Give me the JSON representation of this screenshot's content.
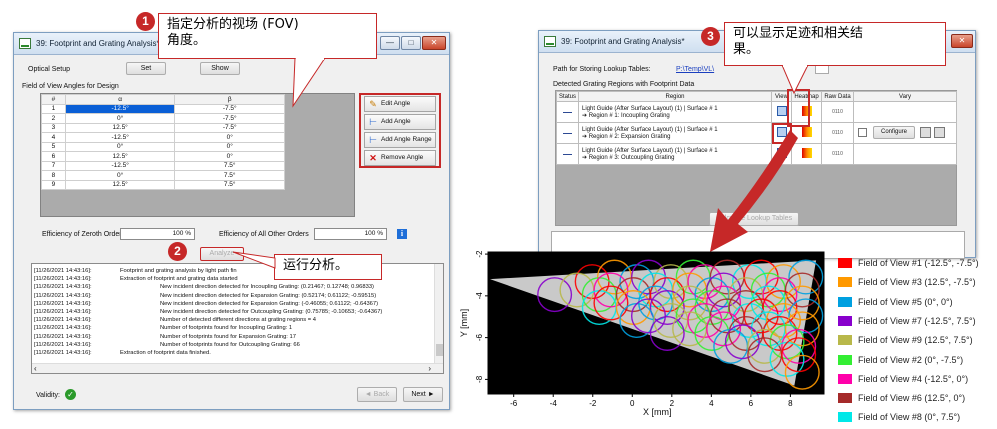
{
  "left_window": {
    "title": "39: Footprint and Grating Analysis*",
    "controls": {
      "minimize": "—",
      "maximize": "□",
      "close": "✕"
    },
    "optical_setup_label": "Optical Setup",
    "set_button": "Set",
    "show_button": "Show",
    "fov_section_label": "Field of View Angles for Design",
    "table_headers": [
      "#",
      "α",
      "β"
    ],
    "rows": [
      [
        "1",
        "-12.5°",
        "-7.5°"
      ],
      [
        "2",
        "0°",
        "-7.5°"
      ],
      [
        "3",
        "12.5°",
        "-7.5°"
      ],
      [
        "4",
        "-12.5°",
        "0°"
      ],
      [
        "5",
        "0°",
        "0°"
      ],
      [
        "6",
        "12.5°",
        "0°"
      ],
      [
        "7",
        "-12.5°",
        "7.5°"
      ],
      [
        "8",
        "0°",
        "7.5°"
      ],
      [
        "9",
        "12.5°",
        "7.5°"
      ]
    ],
    "side_buttons": [
      "Edit Angle",
      "Add Angle",
      "Add Angle Range",
      "Remove Angle"
    ],
    "zeroth_order_label": "Efficiency of Zeroth Order",
    "zeroth_order_value": "100 %",
    "other_orders_label": "Efficiency of All Other Orders",
    "other_orders_value": "100 %",
    "info_icon": "i",
    "analyze_button": "Analyze",
    "log_lines": [
      [
        "[11/26/2021 14:43:16]:",
        "Footprint and grating analysis by light path fin"
      ],
      [
        "[11/26/2021 14:43:16]:",
        "Extraction of footprint and grating data started"
      ],
      [
        "[11/26/2021 14:43:16]:",
        "New incident direction detected for Incoupling Grating: (0.21467; 0.12748; 0.96833)"
      ],
      [
        "[11/26/2021 14:43:16]:",
        "New incident direction detected for Expansion Grating: (0.52174; 0.61122; -0.59515)"
      ],
      [
        "[11/26/2021 14:43:16]:",
        "New incident direction detected for Expansion Grating: (-0.46055; 0.61122; -0.64367)"
      ],
      [
        "[11/26/2021 14:43:16]:",
        "New incident direction detected for Outcoupling Grating: (0.75785; -0.10653; -0.64367)"
      ],
      [
        "[11/26/2021 14:43:16]:",
        "Number of detected different directions at grating regions = 4"
      ],
      [
        "[11/26/2021 14:43:16]:",
        "Number of footprints found for Incoupling Grating: 1"
      ],
      [
        "[11/26/2021 14:43:16]:",
        "Number of footprints found for Expansion Grating: 17"
      ],
      [
        "[11/26/2021 14:43:16]:",
        "Number of footprints found for Outcoupling Grating: 66"
      ],
      [
        "[11/26/2021 14:43:16]:",
        "Extraction of footprint data finished."
      ]
    ],
    "validity_label": "Validity:",
    "back_button": "◄ Back",
    "next_button": "Next ►"
  },
  "callouts": {
    "c1_number": "1",
    "c1_text_line1": "指定分析的视场  (FOV)",
    "c1_text_line2": "角度。",
    "c2_number": "2",
    "c2_text": "运行分析。",
    "c3_number": "3",
    "c3_text_line1": "可以显示足迹和相关结",
    "c3_text_line2": "果。"
  },
  "right_window": {
    "title": "39: Footprint and Grating Analysis*",
    "path_label": "Path for Storing Lookup Tables:",
    "path_link": "P:\\Temp\\VL\\",
    "detected_label": "Detected Grating Regions with Footprint Data",
    "headers": [
      "Status",
      "Region",
      "View",
      "Heatmap",
      "Raw Data",
      "Vary"
    ],
    "regions": [
      {
        "line1": "Light Guide (After Surface Layout) (1) | Surface # 1",
        "line2": "➔ Region # 1: Incoupling Grating"
      },
      {
        "line1": "Light Guide (After Surface Layout) (1) | Surface # 1",
        "line2": "➔ Region # 2: Expansion Grating"
      },
      {
        "line1": "Light Guide (After Surface Layout) (1) | Surface # 1",
        "line2": "➔ Region # 3: Outcoupling Grating"
      }
    ],
    "status_symbol": "—",
    "raw_data_icon": "0110",
    "configure_button": "Configure",
    "calc_button": "Calculate Lookup Tables"
  },
  "plot": {
    "xlabel": "X [mm]",
    "ylabel": "Y [mm]",
    "xticks": [
      "-6",
      "-4",
      "-2",
      "0",
      "2",
      "4",
      "6",
      "8"
    ],
    "yticks": [
      "-2",
      "-4",
      "-6",
      "-8"
    ],
    "xlim": [
      -7.3,
      9.7
    ],
    "ylim": [
      -8.7,
      -1.9
    ],
    "legend": [
      {
        "label": "Field of View #1 (-12.5°, -7.5°)",
        "color": "#ff0000"
      },
      {
        "label": "Field of View #3 (12.5°, -7.5°)",
        "color": "#ff9900"
      },
      {
        "label": "Field of View #5 (0°, 0°)",
        "color": "#00a0e0"
      },
      {
        "label": "Field of View #7 (-12.5°, 7.5°)",
        "color": "#8800cc"
      },
      {
        "label": "Field of View #9 (12.5°, 7.5°)",
        "color": "#b8b84a"
      },
      {
        "label": "Field of View #2 (0°, -7.5°)",
        "color": "#33ee33"
      },
      {
        "label": "Field of View #4 (-12.5°, 0°)",
        "color": "#ff00aa"
      },
      {
        "label": "Field of View #6 (12.5°, 0°)",
        "color": "#a52a2a"
      },
      {
        "label": "Field of View #8 (0°, 7.5°)",
        "color": "#00e8e8"
      }
    ]
  }
}
